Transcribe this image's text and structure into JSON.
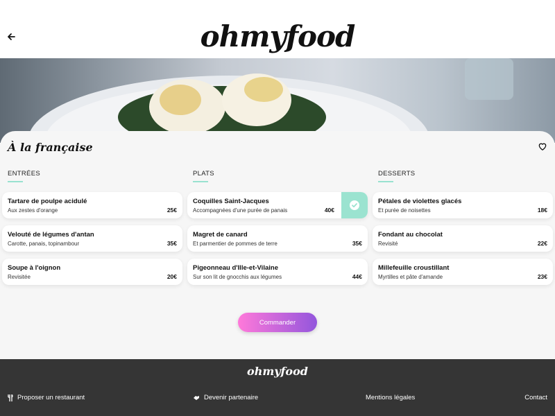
{
  "header": {
    "logo": "ohmyfood"
  },
  "restaurant": {
    "title": "À la française"
  },
  "sections": [
    {
      "title": "ENTRÉES",
      "dishes": [
        {
          "name": "Tartare de poulpe acidulé",
          "description": "Aux zestes d'orange",
          "price": "25€"
        },
        {
          "name": "Velouté de légumes d'antan",
          "description": "Carotte, panais, topinambour",
          "price": "35€"
        },
        {
          "name": "Soupe à l'oignon",
          "description": "Revisitée",
          "price": "20€"
        }
      ]
    },
    {
      "title": "PLATS",
      "dishes": [
        {
          "name": "Coquilles Saint-Jacques",
          "description": "Accompagnées d'une purée de panais",
          "price": "40€",
          "selected": true
        },
        {
          "name": "Magret de canard",
          "description": "Et parmentier de pommes de terre",
          "price": "35€"
        },
        {
          "name": "Pigeonneau d'Ille-et-Vilaine",
          "description": "Sur son lit de gnocchis aux légumes",
          "price": "44€"
        }
      ]
    },
    {
      "title": "DESSERTS",
      "dishes": [
        {
          "name": "Pétales de violettes glacés",
          "description": "Et purée de noisettes",
          "price": "18€"
        },
        {
          "name": "Fondant au chocolat",
          "description": "Revisité",
          "price": "22€"
        },
        {
          "name": "Millefeuille croustillant",
          "description": "Myrtilles et pâte d'amande",
          "price": "23€"
        }
      ]
    }
  ],
  "order_button": "Commander",
  "footer": {
    "logo": "ohmyfood",
    "links": [
      {
        "label": "Proposer un restaurant",
        "icon": "utensils-icon"
      },
      {
        "label": "Devenir partenaire",
        "icon": "handshake-icon"
      },
      {
        "label": "Mentions légales"
      },
      {
        "label": "Contact"
      }
    ]
  },
  "colors": {
    "accent": "#99e2d0",
    "button_start": "#ff79da",
    "button_end": "#9356dc",
    "footer_bg": "#353535"
  }
}
